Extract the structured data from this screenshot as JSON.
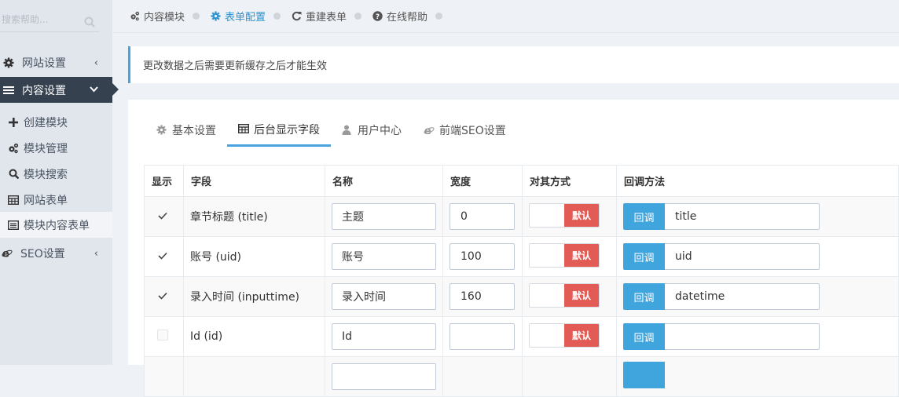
{
  "sidebar": {
    "search_placeholder": "搜索帮助...",
    "items": [
      {
        "label": "网站设置",
        "icon": "gear-icon"
      },
      {
        "label": "内容设置",
        "icon": "bars-icon"
      },
      {
        "label": "SEO设置",
        "icon": "ie-icon"
      }
    ],
    "subitems": [
      {
        "label": "创建模块",
        "icon": "plus-icon"
      },
      {
        "label": "模块管理",
        "icon": "gears-icon"
      },
      {
        "label": "模块搜索",
        "icon": "search-icon"
      },
      {
        "label": "网站表单",
        "icon": "table-icon"
      },
      {
        "label": "模块内容表单",
        "icon": "list-icon"
      }
    ]
  },
  "breadcrumb": [
    {
      "label": "内容模块",
      "icon": "gears-icon"
    },
    {
      "label": "表单配置",
      "icon": "gear-icon"
    },
    {
      "label": "重建表单",
      "icon": "refresh-icon"
    },
    {
      "label": "在线帮助",
      "icon": "question-icon"
    }
  ],
  "note": "更改数据之后需要更新缓存之后才能生效",
  "tabs": [
    {
      "label": "基本设置",
      "icon": "gear-icon"
    },
    {
      "label": "后台显示字段",
      "icon": "table-icon"
    },
    {
      "label": "用户中心",
      "icon": "user-icon"
    },
    {
      "label": "前端SEO设置",
      "icon": "ie-icon"
    }
  ],
  "table": {
    "headers": [
      "显示",
      "字段",
      "名称",
      "宽度",
      "对其方式",
      "回调方法"
    ],
    "rows": [
      {
        "checked": true,
        "field": "章节标题 (title)",
        "name": "主题",
        "width": "0",
        "align": "默认",
        "callback_btn": "回调",
        "callback": "title"
      },
      {
        "checked": true,
        "field": "账号 (uid)",
        "name": "账号",
        "width": "100",
        "align": "默认",
        "callback_btn": "回调",
        "callback": "uid"
      },
      {
        "checked": true,
        "field": "录入时间 (inputtime)",
        "name": "录入时间",
        "width": "160",
        "align": "默认",
        "callback_btn": "回调",
        "callback": "datetime"
      },
      {
        "checked": false,
        "field": "Id (id)",
        "name": "Id",
        "width": "",
        "align": "默认",
        "callback_btn": "回调",
        "callback": ""
      }
    ]
  },
  "colors": {
    "accent": "#48a4e0",
    "danger": "#e25b55",
    "sidebar_active": "#364150"
  }
}
